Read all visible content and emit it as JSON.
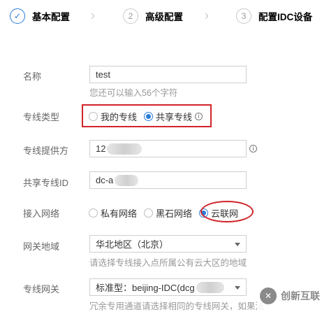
{
  "steps": [
    {
      "number": "✓",
      "label": "基本配置"
    },
    {
      "number": "2",
      "label": "高级配置"
    },
    {
      "number": "3",
      "label": "配置IDC设备"
    }
  ],
  "form": {
    "name": {
      "label": "名称",
      "value": "test",
      "hint": "您还可以输入56个字符"
    },
    "type": {
      "label": "专线类型",
      "options": [
        "我的专线",
        "共享专线"
      ],
      "selected": "共享专线"
    },
    "provider": {
      "label": "专线提供方",
      "value": "12"
    },
    "share_id": {
      "label": "共享专线ID",
      "value": "dc-a"
    },
    "network": {
      "label": "接入网络",
      "options": [
        "私有网络",
        "黑石网络",
        "云联网"
      ],
      "selected": "云联网"
    },
    "region": {
      "label": "网关地域",
      "value": "华北地区（北京）",
      "hint": "请选择专线接入点所属公有云大区的地域"
    },
    "gateway": {
      "label": "专线网关",
      "value": "标准型：beijing-IDC(dcg",
      "hint": "冗余专用通道请选择相同的专线网关，如果法"
    }
  },
  "watermark": {
    "text": "创新互联"
  },
  "colors": {
    "accent": "#2b7cd9",
    "highlight": "#d0242b"
  }
}
